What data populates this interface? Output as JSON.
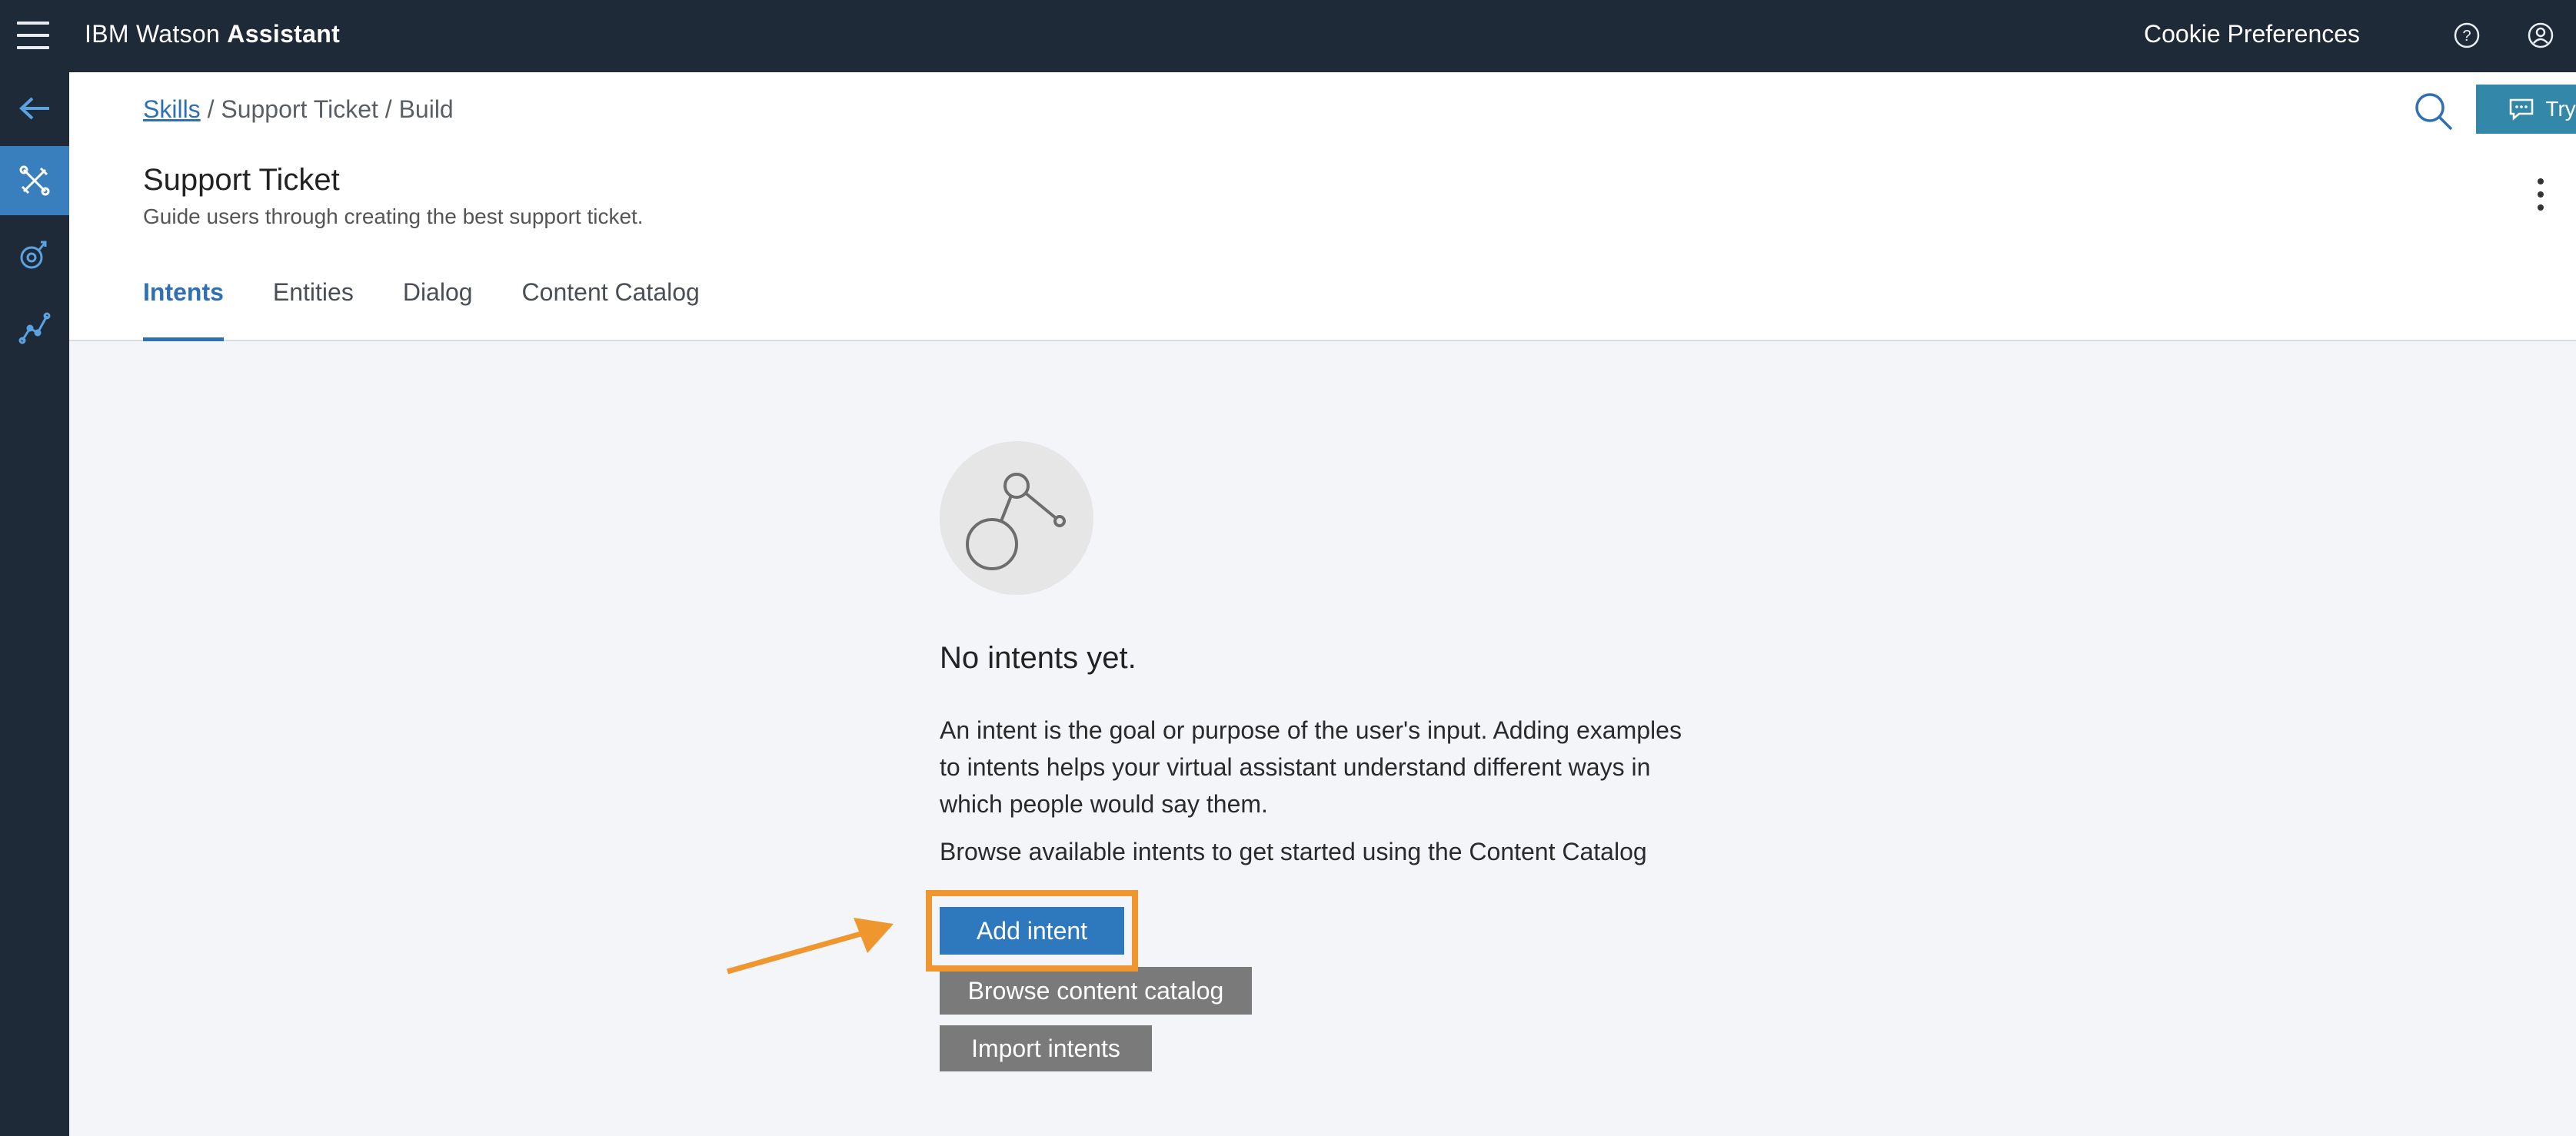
{
  "topbar": {
    "brand_prefix": "IBM Watson ",
    "brand_bold": "Assistant",
    "cookie_label": "Cookie Preferences",
    "icons": [
      "menu-icon",
      "help-icon",
      "user-icon"
    ]
  },
  "rail": {
    "items": [
      "back-arrow-icon",
      "skills-icon",
      "assistants-icon",
      "analytics-icon"
    ],
    "active_index": 1
  },
  "header": {
    "breadcrumb_link": "Skills",
    "breadcrumb_rest": "/ Support Ticket / Build",
    "title": "Support Ticket",
    "subtitle": "Guide users through creating the best support ticket.",
    "try_it_label": "Try it"
  },
  "tabs": [
    {
      "label": "Intents",
      "active": true
    },
    {
      "label": "Entities",
      "active": false
    },
    {
      "label": "Dialog",
      "active": false
    },
    {
      "label": "Content Catalog",
      "active": false
    }
  ],
  "empty_state": {
    "title": "No intents yet.",
    "description": "An intent is the goal or purpose of the user's input. Adding examples to intents helps your virtual assistant understand different ways in which people would say them.",
    "browse_text": "Browse available intents to get started using the Content Catalog",
    "add_intent_label": "Add intent",
    "browse_catalog_label": "Browse content catalog",
    "import_label": "Import intents"
  },
  "colors": {
    "topbar": "#1e2a38",
    "accent": "#2e78bd",
    "tryit": "#3387a8",
    "highlight": "#f0962e",
    "secondary_button": "#7a7a7a"
  }
}
